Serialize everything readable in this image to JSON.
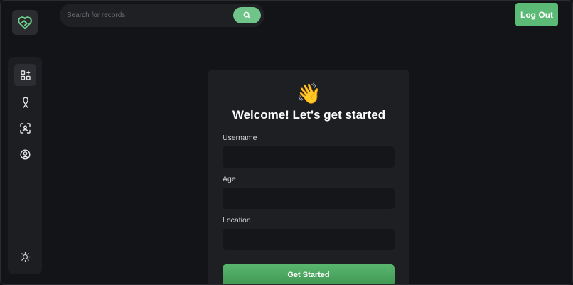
{
  "header": {
    "search": {
      "placeholder": "Search for records",
      "value": ""
    },
    "logout_label": "Log Out"
  },
  "sidebar": {
    "items": [
      {
        "icon": "dashboard-icon",
        "active": true
      },
      {
        "icon": "ribbon-icon",
        "active": false
      },
      {
        "icon": "scan-face-icon",
        "active": false
      },
      {
        "icon": "user-circle-icon",
        "active": false
      }
    ],
    "theme_toggle_icon": "sun-icon"
  },
  "form": {
    "emoji": "👋",
    "title": "Welcome! Let's get started",
    "fields": [
      {
        "label": "Username",
        "value": ""
      },
      {
        "label": "Age",
        "value": ""
      },
      {
        "label": "Location",
        "value": ""
      }
    ],
    "submit_label": "Get Started"
  },
  "colors": {
    "accent": "#5bba75",
    "background": "#131418",
    "panel": "#1e1f23"
  }
}
